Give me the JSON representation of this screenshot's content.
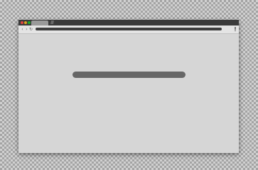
{
  "window": {
    "controls": [
      "close-dot",
      "minimize-dot",
      "maximize-dot"
    ],
    "colors": {
      "close": "#e0443e",
      "minimize": "#dea123",
      "maximize": "#1aab29",
      "titlebar": "#3b3b3b",
      "content": "#d6d6d6"
    }
  },
  "tabs": [
    {
      "label": ""
    }
  ],
  "toolbar": {
    "icons": [
      "back-arrow-icon",
      "forward-arrow-icon",
      "reload-icon",
      "menu-icon"
    ],
    "address_value": ""
  },
  "content": {
    "placeholder_text": ""
  }
}
